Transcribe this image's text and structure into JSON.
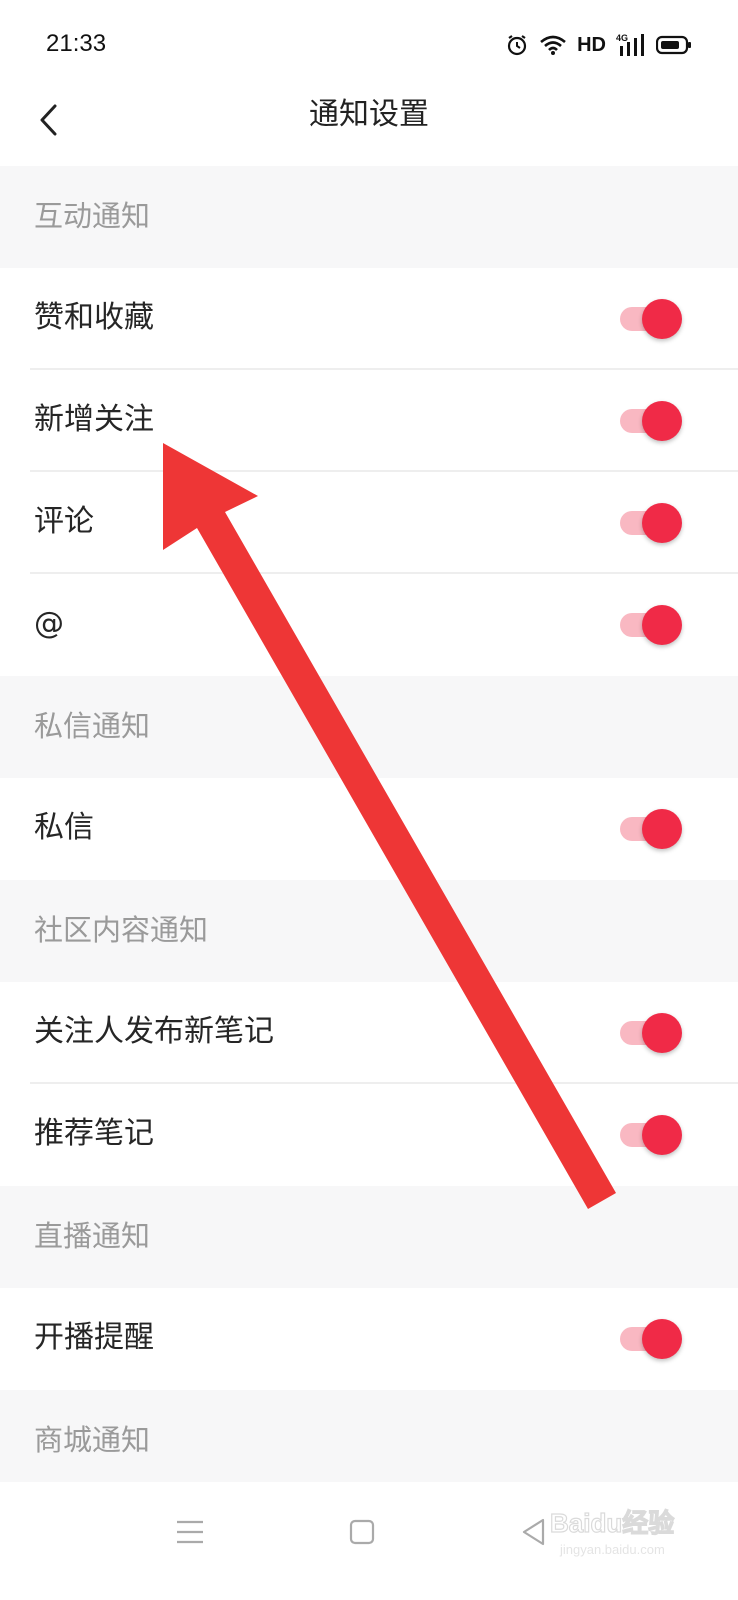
{
  "status_bar": {
    "time": "21:33",
    "network_label": "HD",
    "network_type": "4G"
  },
  "header": {
    "title": "通知设置",
    "back_icon": "chevron-left-icon"
  },
  "sections": [
    {
      "title": "互动通知",
      "items": [
        {
          "label": "赞和收藏",
          "enabled": true
        },
        {
          "label": "新增关注",
          "enabled": true
        },
        {
          "label": "评论",
          "enabled": true
        },
        {
          "label": "@",
          "enabled": true
        }
      ]
    },
    {
      "title": "私信通知",
      "items": [
        {
          "label": "私信",
          "enabled": true
        }
      ]
    },
    {
      "title": "社区内容通知",
      "items": [
        {
          "label": "关注人发布新笔记",
          "enabled": true
        },
        {
          "label": "推荐笔记",
          "enabled": true
        }
      ]
    },
    {
      "title": "直播通知",
      "items": [
        {
          "label": "开播提醒",
          "enabled": true
        }
      ]
    },
    {
      "title": "商城通知",
      "items": []
    }
  ],
  "colors": {
    "toggle_on_knob": "#f02a47",
    "toggle_on_track": "#f9b8c2",
    "section_bg": "#f7f7f8",
    "annotation_arrow": "#ee3636"
  },
  "watermark": {
    "brand": "Baidu经验",
    "url": "jingyan.baidu.com"
  }
}
